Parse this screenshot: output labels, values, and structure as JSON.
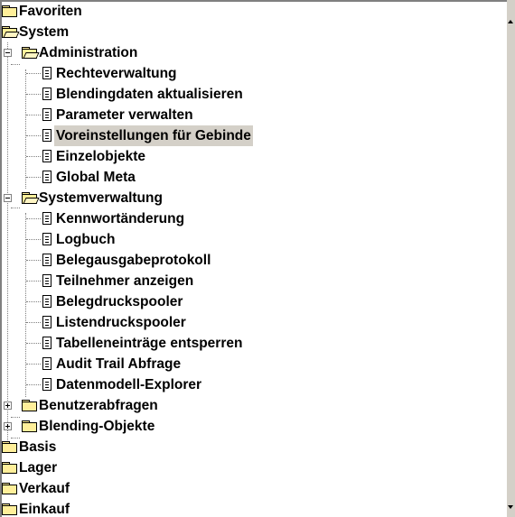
{
  "tree": {
    "top": [
      {
        "label": "Favoriten",
        "icon": "folder-icon"
      },
      {
        "label": "System",
        "icon": "open-folder-icon"
      }
    ],
    "administration": {
      "label": "Administration",
      "icon": "open-folder-icon",
      "children": [
        "Rechteverwaltung",
        "Blendingdaten aktualisieren",
        "Parameter verwalten",
        "Voreinstellungen für Gebinde",
        "Einzelobjekte",
        "Global Meta"
      ],
      "selected_index": 3
    },
    "systemverwaltung": {
      "label": "Systemverwaltung",
      "icon": "open-folder-icon",
      "children": [
        "Kennwortänderung",
        "Logbuch",
        "Belegausgabeprotokoll",
        "Teilnehmer anzeigen",
        "Belegdruckspooler",
        "Listendruckspooler",
        "Tabelleneinträge entsperren",
        "Audit Trail Abfrage",
        "Datenmodell-Explorer"
      ]
    },
    "collapsed": [
      {
        "label": "Benutzerabfragen",
        "icon": "folder-icon"
      },
      {
        "label": "Blending-Objekte",
        "icon": "folder-icon"
      }
    ],
    "bottom": [
      {
        "label": "Basis",
        "icon": "folder-icon"
      },
      {
        "label": "Lager",
        "icon": "folder-icon"
      },
      {
        "label": "Verkauf",
        "icon": "folder-icon"
      },
      {
        "label": "Einkauf",
        "icon": "folder-icon"
      }
    ]
  },
  "colors": {
    "selection_bg": "#d4d0c8",
    "folder_fill": "#ffef9a",
    "tree_lines": "#808080"
  }
}
